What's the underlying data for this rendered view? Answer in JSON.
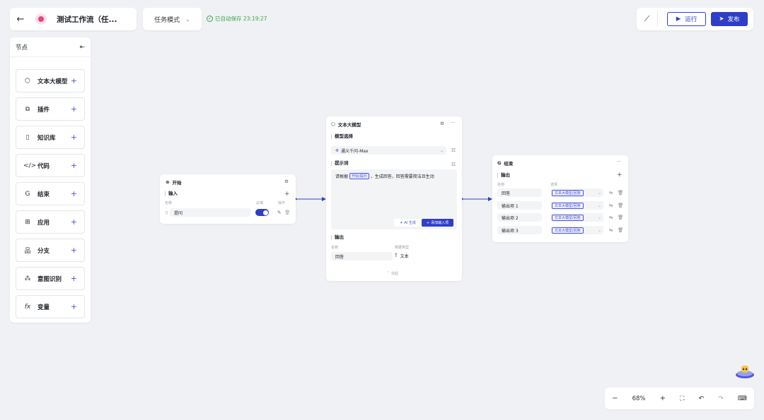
{
  "header": {
    "back_icon": "arrow-left-icon",
    "app_icon": "app-icon",
    "title": "测试工作流（任...",
    "mode": "任务模式",
    "autosave": "已自动保存 23:19:27",
    "run_label": "运行",
    "publish_label": "发布"
  },
  "node_panel": {
    "title": "节点",
    "items": [
      {
        "label": "文本大模型",
        "icon": "cube-icon"
      },
      {
        "label": "插件",
        "icon": "puzzle-icon"
      },
      {
        "label": "知识库",
        "icon": "book-icon"
      },
      {
        "label": "代码",
        "icon": "code-icon"
      },
      {
        "label": "结束",
        "icon": "end-icon"
      },
      {
        "label": "应用",
        "icon": "grid-icon"
      },
      {
        "label": "分支",
        "icon": "branch-icon"
      },
      {
        "label": "意图识别",
        "icon": "intent-icon"
      },
      {
        "label": "变量",
        "icon": "fx-icon"
      }
    ]
  },
  "start_node": {
    "title": "开始",
    "input_label": "输入",
    "col_name": "名称",
    "col_required": "必填",
    "col_action": "操作",
    "field_value": "提问"
  },
  "llm_node": {
    "title": "文本大模型",
    "model_section": "模型选择",
    "model_value": "通义千问-Max",
    "prompt_section": "提示词",
    "prompt_prefix": "请根据",
    "prompt_tag": "开始/提问",
    "prompt_suffix": "，生成回答，回答需要简洁且生动",
    "ai_generate": "AI 生成",
    "add_input": "添加输入项",
    "output_section": "输出",
    "col_name": "名称",
    "col_type": "数据类型",
    "output_name": "回答",
    "output_type": "文本",
    "collapse": "收起"
  },
  "end_node": {
    "title": "结束",
    "output_label": "输出",
    "col_name": "名称",
    "col_value": "选择",
    "rows": [
      {
        "name": "回答",
        "tag": "文本大模型/回答"
      },
      {
        "name": "输出项 1",
        "tag": "文本大模型/回答"
      },
      {
        "name": "输出项 2",
        "tag": "文本大模型/回答"
      },
      {
        "name": "输出项 3",
        "tag": "文本大模型/回答"
      }
    ]
  },
  "zoom": {
    "level": "68%"
  },
  "colors": {
    "accent": "#2e3ec9",
    "saved": "#3aa54a",
    "canvas": "#f0f1f4"
  }
}
